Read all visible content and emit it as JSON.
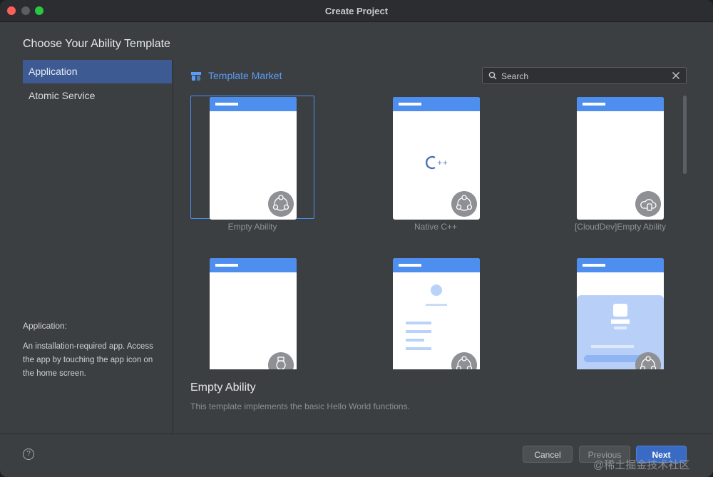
{
  "window": {
    "title": "Create Project"
  },
  "heading": "Choose Your Ability Template",
  "sidebar": {
    "items": [
      {
        "label": "Application",
        "active": true
      },
      {
        "label": "Atomic Service",
        "active": false
      }
    ],
    "description_title": "Application:",
    "description": "An installation-required app. Access the app by touching the app icon on the home screen."
  },
  "market": {
    "label": "Template Market",
    "icon": "template-market-icon"
  },
  "search": {
    "placeholder": "Search",
    "value": ""
  },
  "templates": [
    {
      "label": "Empty Ability",
      "icon": "ability-cluster-icon",
      "selected": true
    },
    {
      "label": "Native C++",
      "icon": "ability-cluster-icon",
      "selected": false
    },
    {
      "label": "[CloudDev]Empty Ability",
      "icon": "cloud-device-icon",
      "selected": false
    },
    {
      "label": "",
      "icon": "watch-icon",
      "selected": false
    },
    {
      "label": "",
      "icon": "ability-cluster-icon",
      "selected": false
    },
    {
      "label": "",
      "icon": "ability-cluster-icon",
      "selected": false
    }
  ],
  "detail": {
    "title": "Empty Ability",
    "description": "This template implements the basic Hello World functions."
  },
  "footer": {
    "help": "?",
    "cancel": "Cancel",
    "previous": "Previous",
    "next": "Next"
  },
  "watermark": "@稀土掘金技术社区",
  "colors": {
    "accent": "#4d8eef",
    "selection": "#3d5a93",
    "window_bg": "#3c3f41"
  }
}
